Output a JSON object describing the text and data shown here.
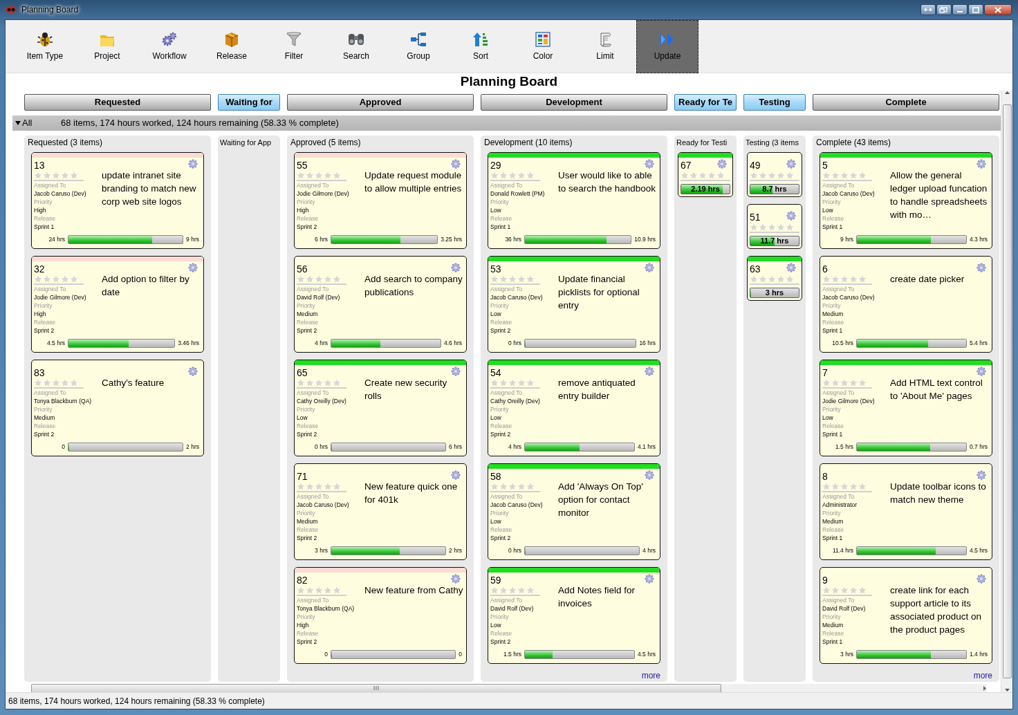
{
  "window": {
    "title": "Planning Board"
  },
  "toolbar": [
    {
      "label": "Item Type",
      "selected": false
    },
    {
      "label": "Project",
      "selected": false
    },
    {
      "label": "Workflow",
      "selected": false
    },
    {
      "label": "Release",
      "selected": false
    },
    {
      "label": "Filter",
      "selected": false
    },
    {
      "label": "Search",
      "selected": false
    },
    {
      "label": "Group",
      "selected": false
    },
    {
      "label": "Sort",
      "selected": false
    },
    {
      "label": "Color",
      "selected": false
    },
    {
      "label": "Limit",
      "selected": false
    },
    {
      "label": "Update",
      "selected": true
    }
  ],
  "board_title": "Planning Board",
  "stage_buttons": [
    {
      "label": "Requested",
      "selected": false
    },
    {
      "label": "Waiting for",
      "selected": true
    },
    {
      "label": "Approved",
      "selected": false
    },
    {
      "label": "Development",
      "selected": false
    },
    {
      "label": "Ready for Te",
      "selected": true
    },
    {
      "label": "Testing",
      "selected": true
    },
    {
      "label": "Complete",
      "selected": false
    }
  ],
  "summary": {
    "toggle": "All",
    "expanded": true,
    "text": "68 items, 174 hours worked, 124 hours remaining (58.33 % complete)"
  },
  "columns": [
    {
      "title": "Requested (3 items)",
      "cards": [
        {
          "kind": "full",
          "id": "13",
          "stars": 0,
          "title": "update intranet site branding to match new corp web site logos",
          "fields": [
            {
              "label": "Assigned To",
              "value": "Jacob Caruso (Dev)"
            },
            {
              "label": "Priority",
              "value": "High"
            },
            {
              "label": "Release",
              "value": "Sprint 1"
            }
          ],
          "worked": "24 hrs",
          "remaining": "9 hrs",
          "level": 0.73,
          "color": "#fadcd4"
        },
        {
          "kind": "full",
          "id": "32",
          "stars": 0,
          "title": "Add option to filter by date",
          "fields": [
            {
              "label": "Assigned To",
              "value": "Jodie Gilmore (Dev)"
            },
            {
              "label": "Priority",
              "value": "High"
            },
            {
              "label": "Release",
              "value": "Sprint 2"
            }
          ],
          "worked": "4.5 hrs",
          "remaining": "3.46 hrs",
          "level": 0.57,
          "color": "#fadcd4"
        },
        {
          "kind": "full",
          "id": "83",
          "stars": 0,
          "title": "Cathy's feature",
          "fields": [
            {
              "label": "Assigned To",
              "value": "Tonya Blackburn (QA)"
            },
            {
              "label": "Priority",
              "value": "Medium"
            },
            {
              "label": "Release",
              "value": "Sprint 2"
            }
          ],
          "worked": "0",
          "remaining": "2 hrs",
          "level": 0
        }
      ]
    },
    {
      "title": "Waiting for App"
    },
    {
      "title": "Approved (5 items)",
      "cards": [
        {
          "kind": "full",
          "id": "55",
          "stars": 0,
          "title": "Update request module to allow multiple entries",
          "fields": [
            {
              "label": "Assigned To",
              "value": "Jodie Gilmore (Dev)"
            },
            {
              "label": "Priority",
              "value": "High"
            },
            {
              "label": "Release",
              "value": "Sprint 2"
            }
          ],
          "worked": "6 hrs",
          "remaining": "3.25 hrs",
          "level": 0.65,
          "color": "#fadcd4"
        },
        {
          "kind": "full",
          "id": "56",
          "stars": 0,
          "title": "Add search to company publications",
          "fields": [
            {
              "label": "Assigned To",
              "value": "David Rolf (Dev)"
            },
            {
              "label": "Priority",
              "value": "Medium"
            },
            {
              "label": "Release",
              "value": "Sprint 2"
            }
          ],
          "worked": "4 hrs",
          "remaining": "4.6 hrs",
          "level": 0.45
        },
        {
          "kind": "full",
          "id": "65",
          "stars": 0,
          "title": "Create new security rolls",
          "fields": [
            {
              "label": "Assigned To",
              "value": "Cathy Oreilly (Dev)"
            },
            {
              "label": "Priority",
              "value": "Low"
            },
            {
              "label": "Release",
              "value": "Sprint 2"
            }
          ],
          "worked": "0 hrs",
          "remaining": "6 hrs",
          "level": 0,
          "color": "#22dd22"
        },
        {
          "kind": "full",
          "id": "71",
          "stars": 0,
          "title": "New feature quick one for 401k",
          "fields": [
            {
              "label": "Assigned To",
              "value": "Jacob Caruso (Dev)"
            },
            {
              "label": "Priority",
              "value": "Medium"
            },
            {
              "label": "Release",
              "value": "Sprint 2"
            }
          ],
          "worked": "3 hrs",
          "remaining": "2 hrs",
          "level": 0.6
        },
        {
          "kind": "full",
          "id": "82",
          "stars": 0,
          "title": "New feature from Cathy",
          "fields": [
            {
              "label": "Assigned To",
              "value": "Tonya Blackburn (QA)"
            },
            {
              "label": "Priority",
              "value": "High"
            },
            {
              "label": "Release",
              "value": "Sprint 2"
            }
          ],
          "worked": "0",
          "remaining": "0",
          "level": 0,
          "color": "#fadcd4"
        }
      ]
    },
    {
      "title": "Development (10 items)",
      "more": "more",
      "cards": [
        {
          "kind": "full",
          "id": "29",
          "stars": 0,
          "title": "User would like to able to search the handbook",
          "fields": [
            {
              "label": "Assigned To",
              "value": "Donald Rowlett (PM)"
            },
            {
              "label": "Priority",
              "value": "Low"
            },
            {
              "label": "Release",
              "value": "Sprint 1"
            }
          ],
          "worked": "36 hrs",
          "remaining": "10.9 hrs",
          "level": 0.77,
          "color": "#22dd22"
        },
        {
          "kind": "full",
          "id": "53",
          "stars": 0,
          "title": "Update financial picklists for optional entry",
          "fields": [
            {
              "label": "Assigned To",
              "value": "Jacob Caruso (Dev)"
            },
            {
              "label": "Priority",
              "value": "Low"
            },
            {
              "label": "Release",
              "value": "Sprint 2"
            }
          ],
          "worked": "0 hrs",
          "remaining": "16 hrs",
          "level": 0,
          "color": "#22dd22"
        },
        {
          "kind": "full",
          "id": "54",
          "stars": 0,
          "title": "remove antiquated entry builder",
          "fields": [
            {
              "label": "Assigned To",
              "value": "Cathy Oreilly (Dev)"
            },
            {
              "label": "Priority",
              "value": "Low"
            },
            {
              "label": "Release",
              "value": "Sprint 2"
            }
          ],
          "worked": "4 hrs",
          "remaining": "4.1 hrs",
          "level": 0.5,
          "color": "#22dd22"
        },
        {
          "kind": "full",
          "id": "58",
          "stars": 0,
          "title": "Add 'Always On Top' option for contact monitor",
          "fields": [
            {
              "label": "Assigned To",
              "value": "Jacob Caruso (Dev)"
            },
            {
              "label": "Priority",
              "value": "Low"
            },
            {
              "label": "Release",
              "value": "Sprint 2"
            }
          ],
          "worked": "0 hrs",
          "remaining": "4 hrs",
          "level": 0,
          "color": "#22dd22"
        },
        {
          "kind": "full",
          "id": "59",
          "stars": 0,
          "title": "Add Notes field for invoices",
          "fields": [
            {
              "label": "Assigned To",
              "value": "David Rolf (Dev)"
            },
            {
              "label": "Priority",
              "value": "Low"
            },
            {
              "label": "Release",
              "value": "Sprint 2"
            }
          ],
          "worked": "1.5 hrs",
          "remaining": "4.5 hrs",
          "level": 0.25,
          "color": "#22dd22"
        }
      ]
    },
    {
      "title": "Ready for Testi",
      "cards": [
        {
          "kind": "compact",
          "id": "67",
          "stars": 0,
          "reading": "2.19 hrs",
          "level": 0.85,
          "color": "#22dd22"
        }
      ]
    },
    {
      "title": "Testing (3 items",
      "cards": [
        {
          "kind": "compact",
          "id": "49",
          "stars": 0,
          "reading": "8.7 hrs",
          "level": 0.45
        },
        {
          "kind": "compact",
          "id": "51",
          "stars": 0,
          "reading": "11.7 hrs",
          "level": 0.5
        },
        {
          "kind": "compact",
          "id": "63",
          "stars": 0,
          "reading": "3 hrs",
          "level": 0,
          "color": "#22dd22"
        }
      ]
    },
    {
      "title": "Complete (43 items)",
      "more": "more",
      "cards": [
        {
          "kind": "full",
          "id": "5",
          "stars": 0,
          "title": "Allow the general ledger upload funcation to handle spreadsheets with mo…",
          "fields": [
            {
              "label": "Assigned To",
              "value": "Jacob Caruso (Dev)"
            },
            {
              "label": "Priority",
              "value": "Low"
            },
            {
              "label": "Release",
              "value": "Sprint 1"
            }
          ],
          "worked": "9 hrs",
          "remaining": "4.3 hrs",
          "level": 0.68,
          "color": "#22dd22"
        },
        {
          "kind": "full",
          "id": "6",
          "stars": 0,
          "title": "create date picker",
          "fields": [
            {
              "label": "Assigned To",
              "value": "Jacob Caruso (Dev)"
            },
            {
              "label": "Priority",
              "value": "Medium"
            },
            {
              "label": "Release",
              "value": "Sprint 1"
            }
          ],
          "worked": "10.5 hrs",
          "remaining": "5.4 hrs",
          "level": 0.65
        },
        {
          "kind": "full",
          "id": "7",
          "stars": 0,
          "title": "Add HTML text control to 'About Me' pages",
          "fields": [
            {
              "label": "Assigned To",
              "value": "Jodie Gilmore (Dev)"
            },
            {
              "label": "Priority",
              "value": "Low"
            },
            {
              "label": "Release",
              "value": "Sprint 1"
            }
          ],
          "worked": "1.5 hrs",
          "remaining": "0.7 hrs",
          "level": 0.67,
          "color": "#22dd22"
        },
        {
          "kind": "full",
          "id": "8",
          "stars": 0,
          "title": "Update toolbar icons to match new theme",
          "fields": [
            {
              "label": "Assigned To",
              "value": "Administrator"
            },
            {
              "label": "Priority",
              "value": "Medium"
            },
            {
              "label": "Release",
              "value": "Sprint 1"
            }
          ],
          "worked": "11.4 hrs",
          "remaining": "4.5 hrs",
          "level": 0.72
        },
        {
          "kind": "full",
          "id": "9",
          "stars": 0,
          "title": "create link for each support article to its associated product on the product pages",
          "fields": [
            {
              "label": "Assigned To",
              "value": "David Rolf (Dev)"
            },
            {
              "label": "Priority",
              "value": "Medium"
            },
            {
              "label": "Release",
              "value": "Sprint 1"
            }
          ],
          "worked": "3 hrs",
          "remaining": "1.4 hrs",
          "level": 0.68
        }
      ]
    }
  ],
  "status_bar": "68 items, 174 hours worked, 124 hours remaining (58.33 % complete)"
}
